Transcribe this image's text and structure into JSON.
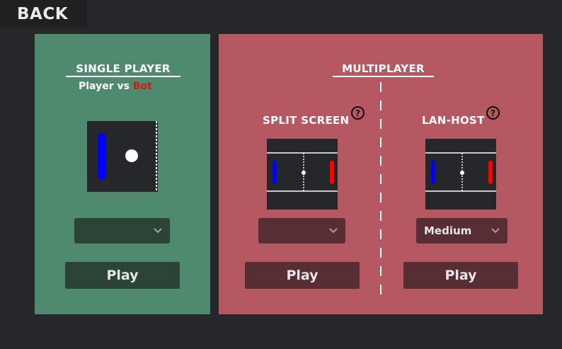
{
  "back_label": "BACK",
  "single": {
    "title": "SINGLE PLAYER",
    "subtitle_prefix": "Player vs ",
    "subtitle_bot": "Bot",
    "difficulty_value": "",
    "play_label": "Play"
  },
  "multi": {
    "title": "MULTIPLAYER",
    "split": {
      "title": "SPLIT SCREEN",
      "help": "?",
      "difficulty_value": "",
      "play_label": "Play"
    },
    "lan": {
      "title": "LAN-HOST",
      "help": "?",
      "difficulty_value": "Medium",
      "play_label": "Play"
    }
  },
  "colors": {
    "single_panel": "#4f8a6e",
    "multi_panel": "#b55861",
    "paddle_blue": "#0000ff",
    "paddle_red": "#ff0000",
    "bot_text": "#cf1d12"
  }
}
